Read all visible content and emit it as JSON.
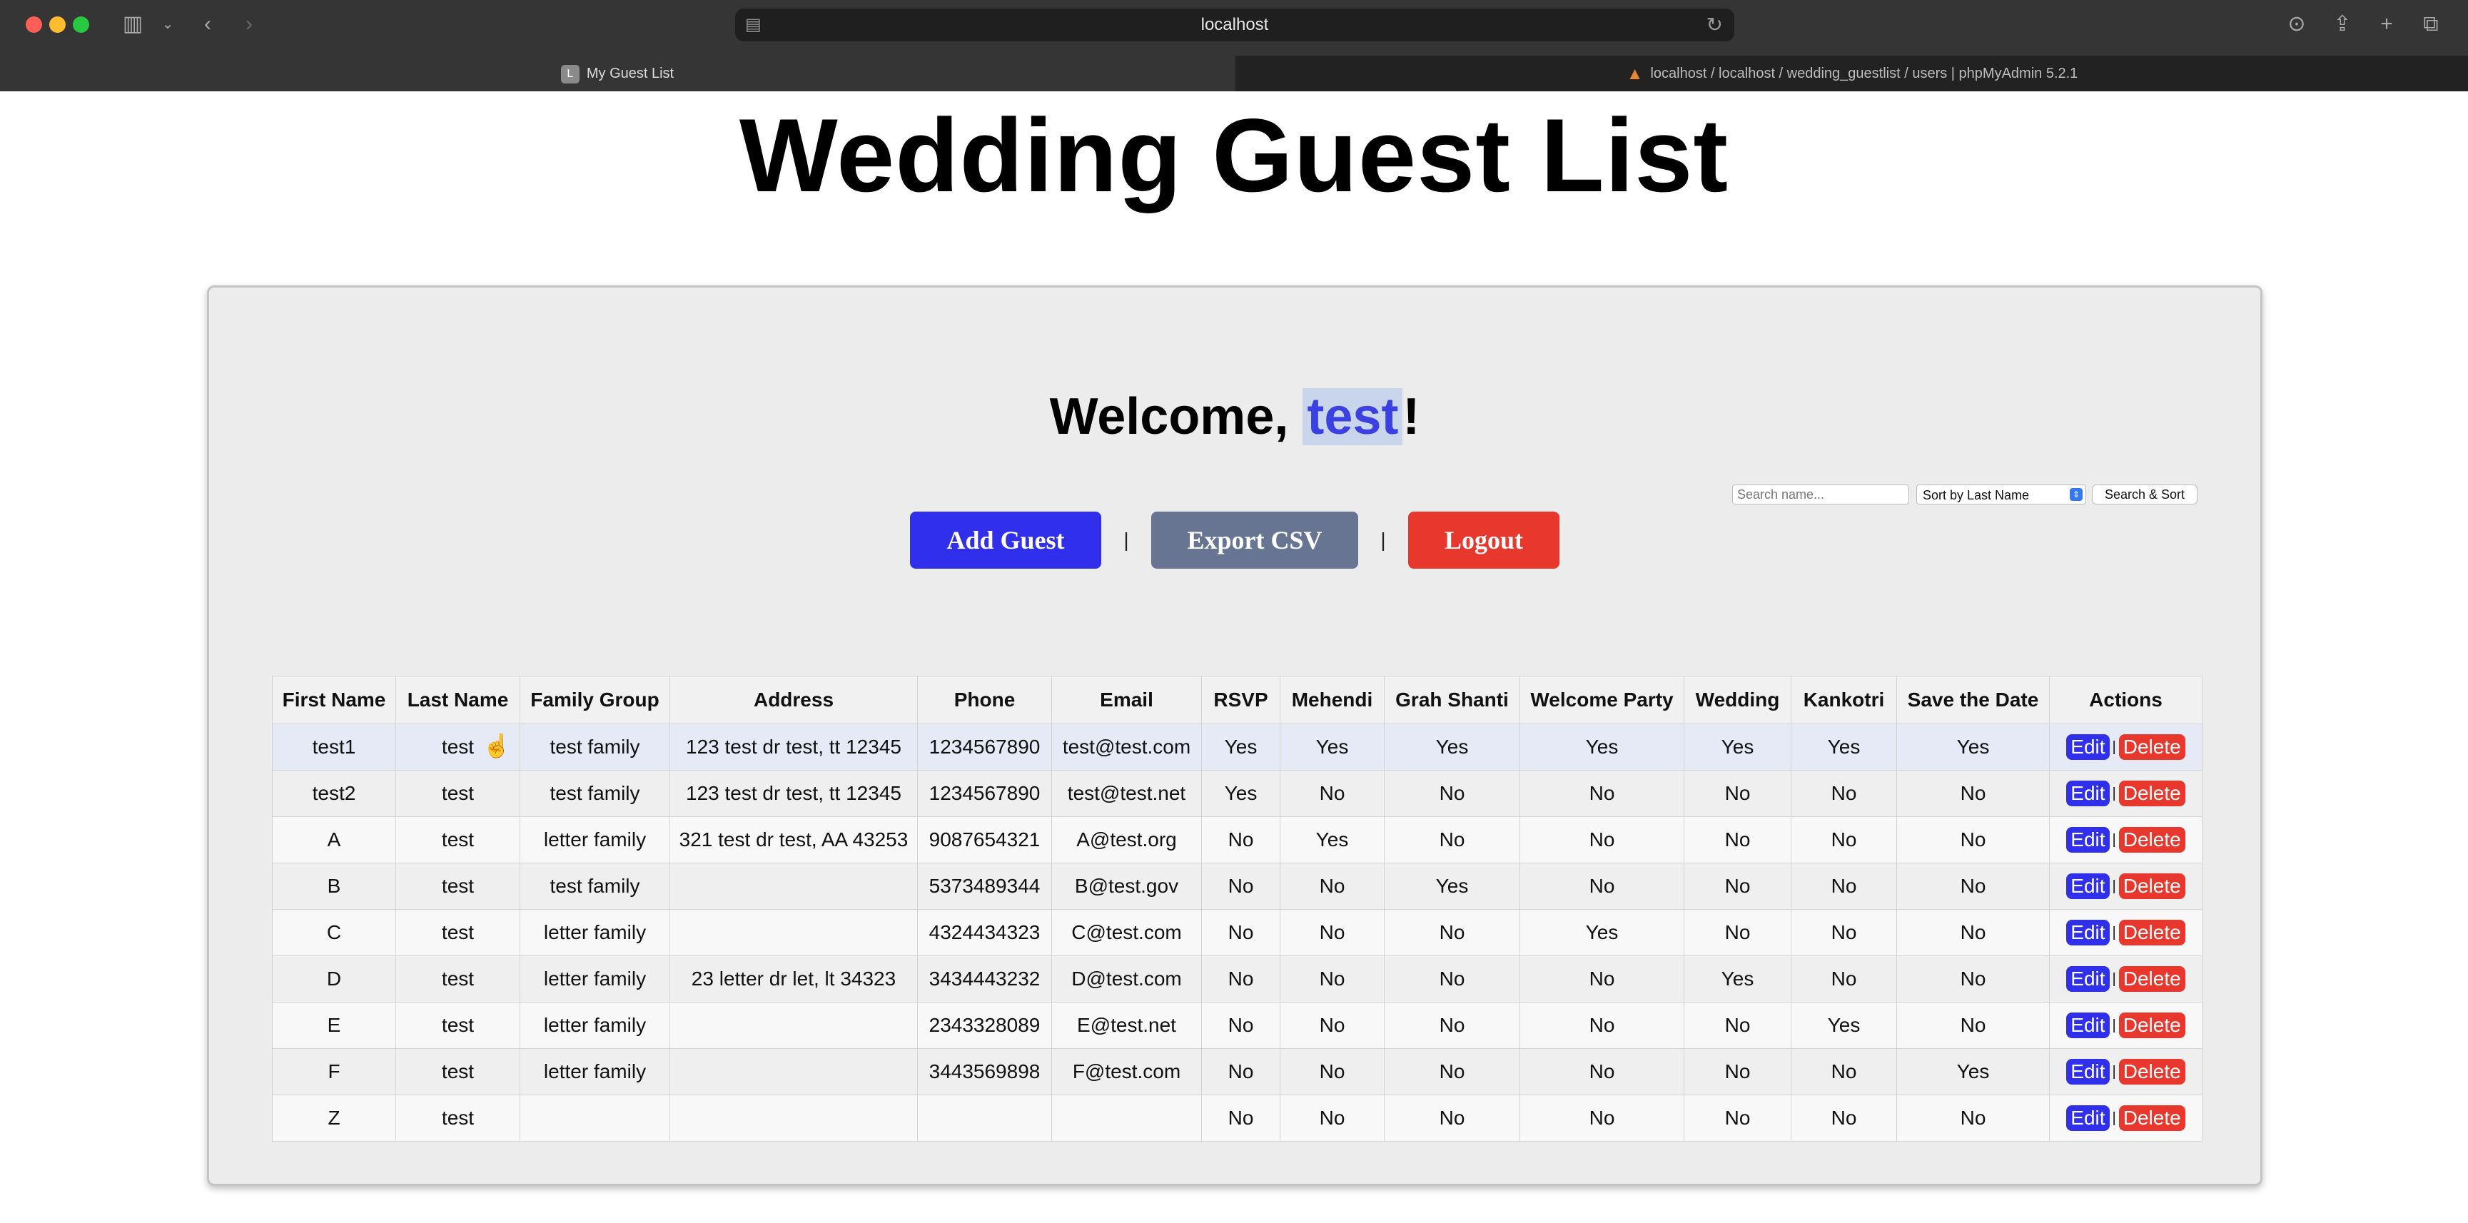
{
  "browser": {
    "url": "localhost",
    "tabs": [
      {
        "label": "My Guest List",
        "favicon": "L",
        "active": true
      },
      {
        "label": "localhost / localhost / wedding_guestlist / users | phpMyAdmin 5.2.1",
        "active": false
      }
    ]
  },
  "page": {
    "title": "Wedding Guest List",
    "welcome_prefix": "Welcome, ",
    "username": "test",
    "welcome_suffix": "!"
  },
  "actions": {
    "add_label": "Add Guest",
    "export_label": "Export CSV",
    "logout_label": "Logout",
    "separator": "|"
  },
  "search": {
    "placeholder": "Search name...",
    "sort_selected": "Sort by Last Name",
    "button_label": "Search & Sort"
  },
  "table": {
    "headers": [
      "First Name",
      "Last Name",
      "Family Group",
      "Address",
      "Phone",
      "Email",
      "RSVP",
      "Mehendi",
      "Grah Shanti",
      "Welcome Party",
      "Wedding",
      "Kankotri",
      "Save the Date",
      "Actions"
    ],
    "edit_label": "Edit",
    "delete_label": "Delete",
    "rows": [
      [
        "test1",
        "test",
        "test family",
        "123 test dr test, tt 12345",
        "1234567890",
        "test@test.com",
        "Yes",
        "Yes",
        "Yes",
        "Yes",
        "Yes",
        "Yes",
        "Yes"
      ],
      [
        "test2",
        "test",
        "test family",
        "123 test dr test, tt 12345",
        "1234567890",
        "test@test.net",
        "Yes",
        "No",
        "No",
        "No",
        "No",
        "No",
        "No"
      ],
      [
        "A",
        "test",
        "letter family",
        "321 test dr test, AA 43253",
        "9087654321",
        "A@test.org",
        "No",
        "Yes",
        "No",
        "No",
        "No",
        "No",
        "No"
      ],
      [
        "B",
        "test",
        "test family",
        "",
        "5373489344",
        "B@test.gov",
        "No",
        "No",
        "Yes",
        "No",
        "No",
        "No",
        "No"
      ],
      [
        "C",
        "test",
        "letter family",
        "",
        "4324434323",
        "C@test.com",
        "No",
        "No",
        "No",
        "Yes",
        "No",
        "No",
        "No"
      ],
      [
        "D",
        "test",
        "letter family",
        "23 letter dr let, lt 34323",
        "3434443232",
        "D@test.com",
        "No",
        "No",
        "No",
        "No",
        "Yes",
        "No",
        "No"
      ],
      [
        "E",
        "test",
        "letter family",
        "",
        "2343328089",
        "E@test.net",
        "No",
        "No",
        "No",
        "No",
        "No",
        "Yes",
        "No"
      ],
      [
        "F",
        "test",
        "letter family",
        "",
        "3443569898",
        "F@test.com",
        "No",
        "No",
        "No",
        "No",
        "No",
        "No",
        "Yes"
      ],
      [
        "Z",
        "test",
        "",
        "",
        "",
        "",
        "No",
        "No",
        "No",
        "No",
        "No",
        "No",
        "No"
      ]
    ]
  },
  "colors": {
    "primary": "#3030ec",
    "secondary": "#687592",
    "danger": "#e8372d",
    "username": "#3a41e0"
  }
}
